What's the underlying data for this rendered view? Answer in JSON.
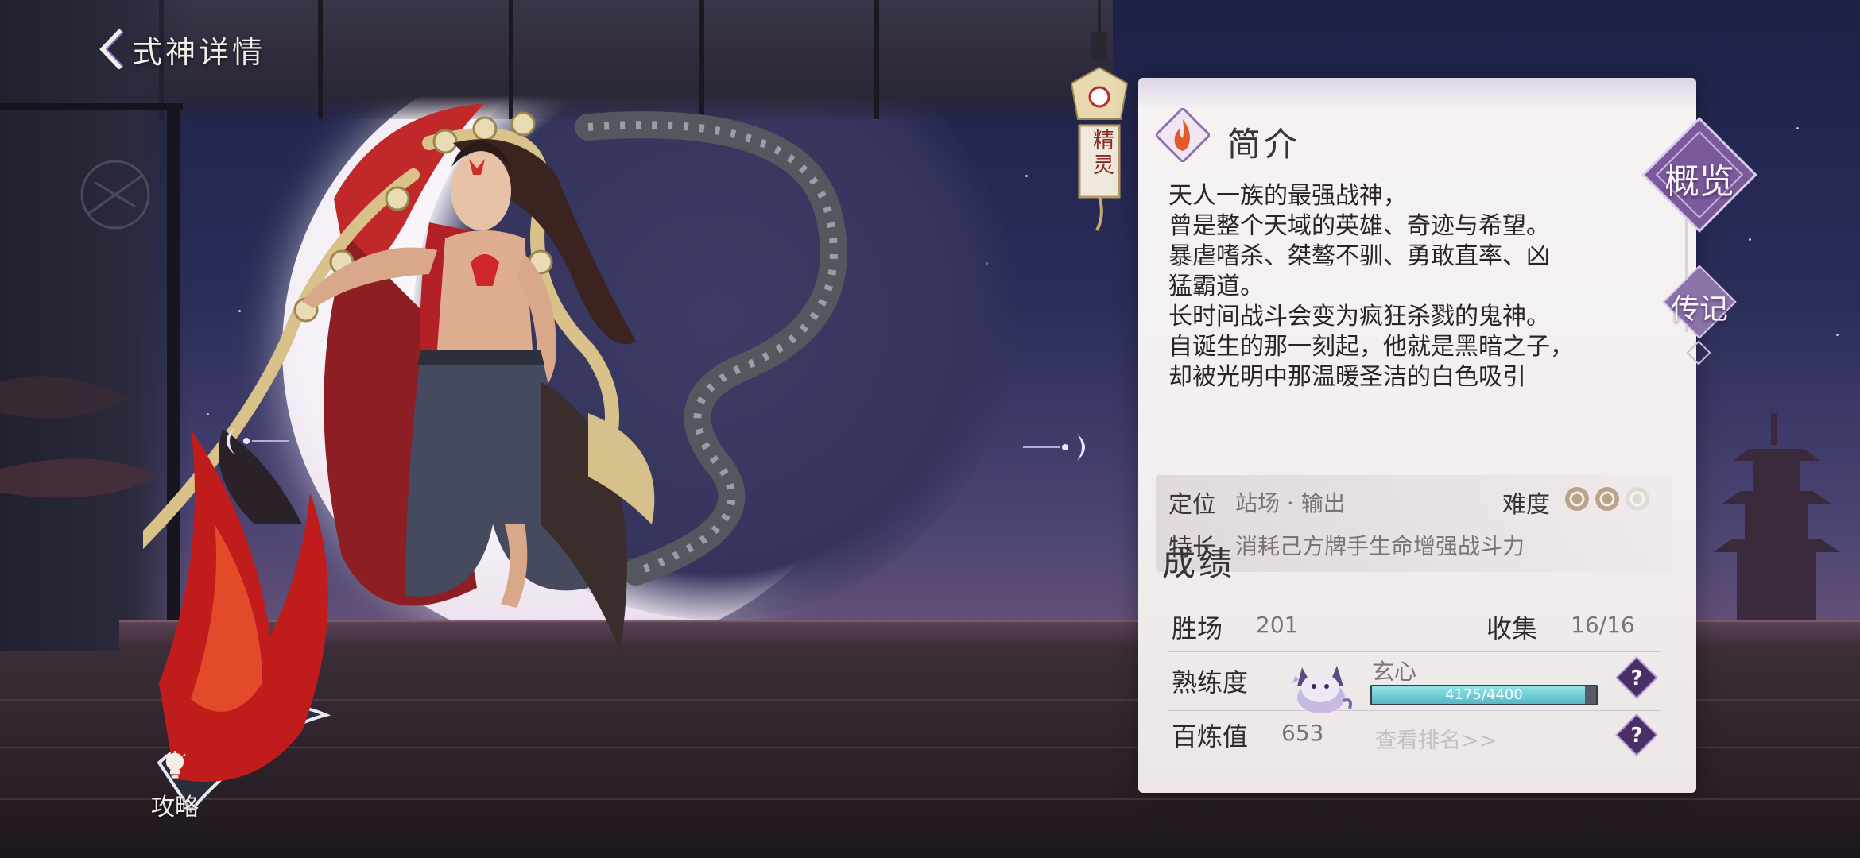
{
  "header": {
    "title": "式神详情"
  },
  "charm": {
    "label": "精灵"
  },
  "guide": {
    "label": "攻略"
  },
  "intro": {
    "heading": "简介",
    "lines": [
      "天人一族的最强战神，",
      "曾是整个天域的英雄、奇迹与希望。",
      "暴虐嗜杀、桀骜不驯、勇敢直率、凶",
      "猛霸道。",
      "长时间战斗会变为疯狂杀戮的鬼神。",
      "自诞生的那一刻起，他就是黑暗之子，",
      "却被光明中那温暖圣洁的白色吸引"
    ]
  },
  "attributes": {
    "role_label": "定位",
    "role_value": "站场 · 输出",
    "difficulty_label": "难度",
    "difficulty_level": 2,
    "difficulty_max": 3,
    "specialty_label": "特长",
    "specialty_value": "消耗己方牌手生命增强战斗力"
  },
  "results": {
    "heading": "成绩",
    "wins_label": "胜场",
    "wins_value": "201",
    "collect_label": "收集",
    "collect_value": "16/16",
    "proficiency_label": "熟练度",
    "proficiency_name": "玄心",
    "proficiency_text": "4175/4400",
    "proficiency_fraction": 0.949,
    "refine_label": "百炼值",
    "refine_value": "653",
    "rank_link": "查看排名>>"
  },
  "tabs": {
    "overview": "概览",
    "biography": "传记"
  },
  "colors": {
    "panel_bg": "#f3efef",
    "accent_purple": "#6a4a8c",
    "progress_fill": "#6fcbd4",
    "help_button": "#4a2f66"
  }
}
